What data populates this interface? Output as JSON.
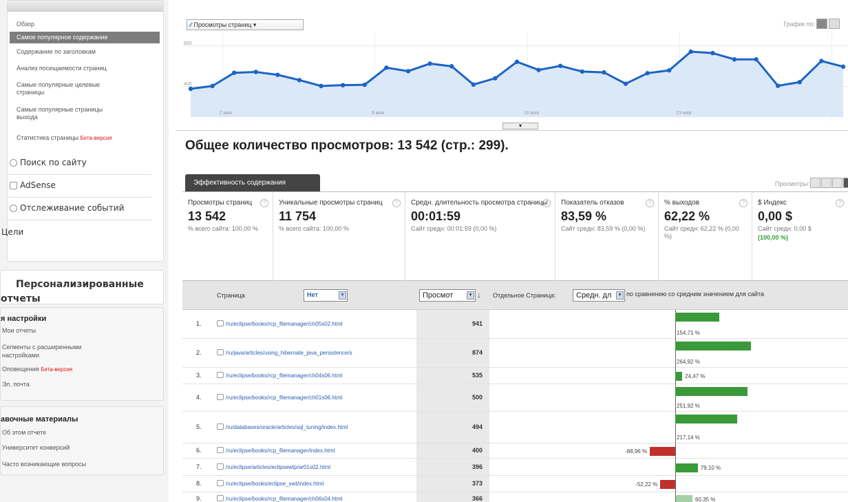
{
  "sidebar": {
    "content_items": [
      {
        "label": "Обзор"
      },
      {
        "label": "Самое популярное содержание"
      },
      {
        "label": "Содержание по заголовкам"
      },
      {
        "label": "Анализ посещаемости страниц"
      },
      {
        "label": "Самые популярные целевые",
        "label2": "страницы"
      },
      {
        "label": "Самые популярные страницы",
        "label2": "выхода"
      },
      {
        "label": "Статистика страницы",
        "beta": "Бета-версия"
      }
    ],
    "sections": [
      "Поиск по сайту",
      "AdSense",
      "Отслеживание событий",
      "Цели"
    ],
    "personalized": {
      "line1": "Персонализированные",
      "line2": "отчеты"
    },
    "settings": {
      "title": "я настройки",
      "items": [
        "Мои отчеты",
        "Сегменты с расширенными",
        "настройками",
        "Оповещения",
        "Эл. почта"
      ],
      "beta": "Бета-версия"
    },
    "help": {
      "title": "авочные материалы",
      "items": [
        "Об этом отчете",
        "Университет конверсий",
        "Часто возникающие вопросы"
      ]
    }
  },
  "chart": {
    "metric_select": "Просмотры страниц",
    "graph_by_label": "График по:",
    "y_ticks": [
      "600",
      "400"
    ],
    "x_ticks": [
      "2 мая",
      "9 мая",
      "16 мая",
      "23 мая"
    ],
    "accent_color": "#1c64c4",
    "fill_color": "#dbe8f7"
  },
  "chart_data": {
    "type": "area",
    "title": "",
    "xlabel": "",
    "ylabel": "",
    "ylim": [
      250,
      650
    ],
    "series": [
      {
        "name": "Просмотры страниц",
        "values": [
          389,
          403,
          468,
          472,
          458,
          432,
          403,
          407,
          409,
          493,
          476,
          513,
          500,
          410,
          441,
          522,
          482,
          502,
          474,
          470,
          414,
          466,
          480,
          572,
          565,
          534,
          534,
          404,
          422,
          526,
          498
        ]
      }
    ],
    "grid": true
  },
  "summary": {
    "title": "Общее количество просмотров: 13 542 (стр.: 299)."
  },
  "tabs": {
    "content_tab": "Эффективность содержания",
    "view_label": "Просмотры:"
  },
  "scorecard": [
    {
      "label": "Просмотры страниц",
      "value": "13 542",
      "sub": "% всего сайта: 100,00 %"
    },
    {
      "label": "Уникальные просмотры страниц",
      "value": "11 754",
      "sub": "% всего сайта: 100,00 %"
    },
    {
      "label": "Средн. длительность просмотра страницы",
      "value": "00:01:59",
      "sub": "Сайт средн: 00:01:59 (0,00 %)"
    },
    {
      "label": "Показатель отказов",
      "value": "83,59 %",
      "sub": "Сайт средн: 83,59 % (0,00 %)"
    },
    {
      "label": "% выходов",
      "value": "62,22 %",
      "sub": "Сайт средн: 62,22 % (0,00 %)"
    },
    {
      "label": "$ Индекс",
      "value": "0,00 $",
      "sub": "Сайт средн: 0,00 $",
      "sub2": "(100,00 %)"
    }
  ],
  "table": {
    "col_page": "Страница",
    "filter_select": "Нет",
    "views_select": "Просмот",
    "sort_arrow": "↓",
    "compare_label": "Отдельное Страница:",
    "compare_select": "Средн. дл",
    "compare_suffix": "по сравнению со средним значением для сайта",
    "rows": [
      {
        "num": "1.",
        "page": "/ru/eclipse/books/rcp_filemanager/ch05s02.html",
        "views": "941",
        "pct": "154,71 %",
        "delta": 154.71
      },
      {
        "num": "2.",
        "page": "/ru/java/articles/using_hibernate_java_persistence/s",
        "views": "874",
        "pct": "264,92 %",
        "delta": 264.92
      },
      {
        "num": "3.",
        "page": "/ru/eclipse/books/rcp_filemanager/ch04s06.html",
        "views": "535",
        "pct": "24,47 %",
        "delta": 24.47
      },
      {
        "num": "4.",
        "page": "/ru/eclipse/books/rcp_filemanager/ch01s06.html",
        "views": "500",
        "pct": "251,92 %",
        "delta": 251.92
      },
      {
        "num": "5.",
        "page": "/ru/databases/oracle/articles/sql_tuning/index.html",
        "views": "494",
        "pct": "217,14 %",
        "delta": 217.14
      },
      {
        "num": "6.",
        "page": "/ru/eclipse/books/rcp_filemanager/index.html",
        "views": "400",
        "pct": "-88,96 %",
        "delta": -88.96
      },
      {
        "num": "7.",
        "page": "/ru/eclipse/articles/eclipsewtp/ar01s02.html",
        "views": "396",
        "pct": "79,10 %",
        "delta": 79.1
      },
      {
        "num": "8.",
        "page": "/ru/eclipse/books/eclipse_swt/index.html",
        "views": "373",
        "pct": "-52,22 %",
        "delta": -52.22
      },
      {
        "num": "9.",
        "page": "/ru/eclipse/books/rcp_filemanager/ch06s04.html",
        "views": "366",
        "pct": "60,35 %",
        "delta": 60.35
      }
    ]
  }
}
